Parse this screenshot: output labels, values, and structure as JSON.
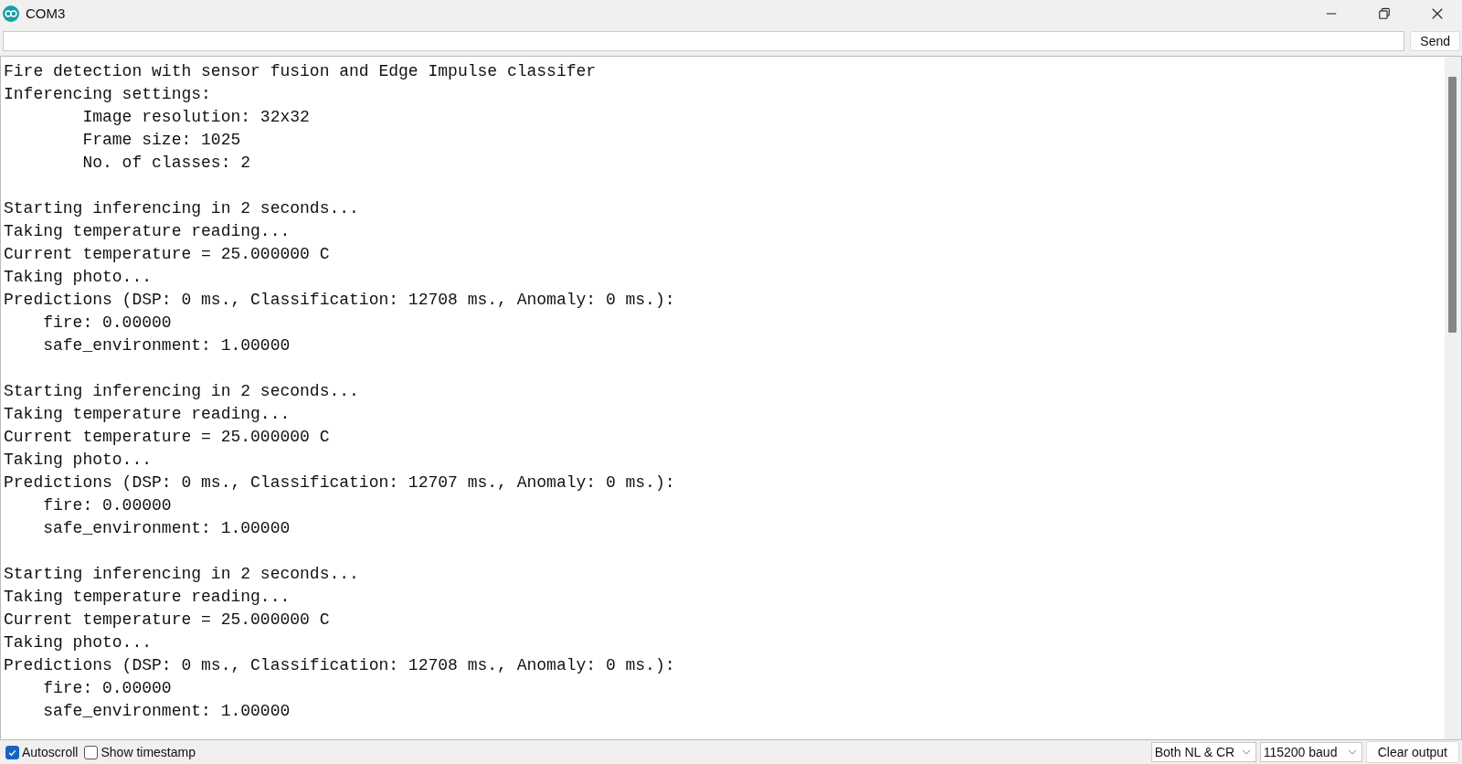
{
  "window": {
    "title": "COM3"
  },
  "send_bar": {
    "button": "Send"
  },
  "output": {
    "blocks": [
      [
        "Fire detection with sensor fusion and Edge Impulse classifer",
        "Inferencing settings:",
        "        Image resolution: 32x32",
        "        Frame size: 1025",
        "        No. of classes: 2"
      ],
      [
        "Starting inferencing in 2 seconds...",
        "Taking temperature reading...",
        "Current temperature = 25.000000 C",
        "Taking photo...",
        "Predictions (DSP: 0 ms., Classification: 12708 ms., Anomaly: 0 ms.):",
        "    fire: 0.00000",
        "    safe_environment: 1.00000"
      ],
      [
        "Starting inferencing in 2 seconds...",
        "Taking temperature reading...",
        "Current temperature = 25.000000 C",
        "Taking photo...",
        "Predictions (DSP: 0 ms., Classification: 12707 ms., Anomaly: 0 ms.):",
        "    fire: 0.00000",
        "    safe_environment: 1.00000"
      ],
      [
        "Starting inferencing in 2 seconds...",
        "Taking temperature reading...",
        "Current temperature = 25.000000 C",
        "Taking photo...",
        "Predictions (DSP: 0 ms., Classification: 12708 ms., Anomaly: 0 ms.):",
        "    fire: 0.00000",
        "    safe_environment: 1.00000"
      ]
    ]
  },
  "status_bar": {
    "checkboxes": [
      {
        "label": "Autoscroll",
        "checked": true
      },
      {
        "label": "Show timestamp",
        "checked": false
      }
    ],
    "line_ending": "Both NL & CR",
    "baud": "115200 baud",
    "clear_button": "Clear output"
  }
}
